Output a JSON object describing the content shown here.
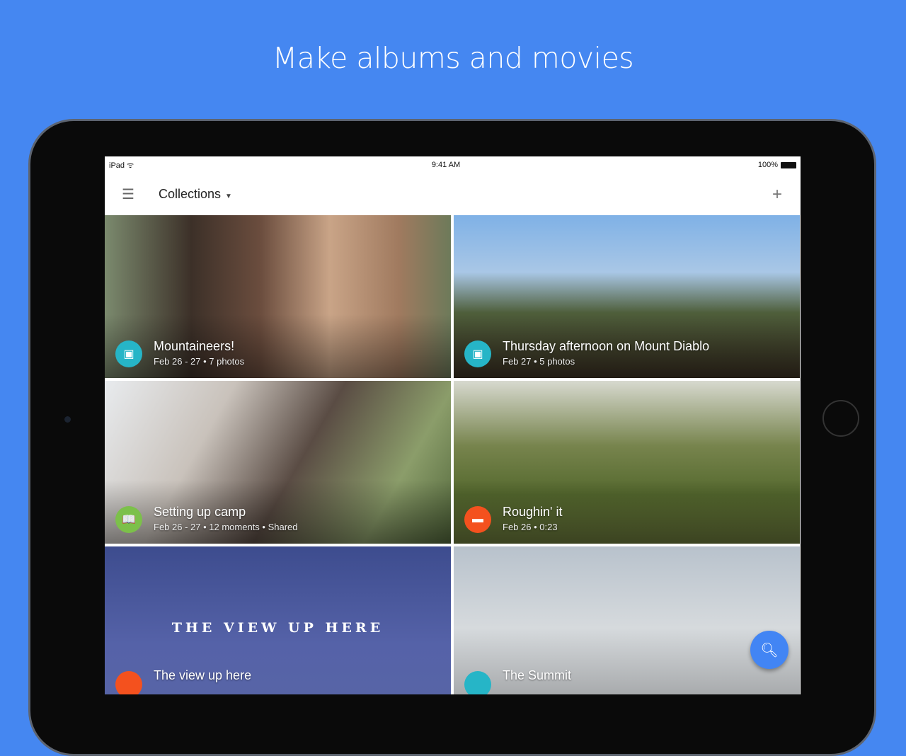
{
  "headline": "Make albums and movies",
  "status": {
    "device": "iPad",
    "time": "9:41 AM",
    "battery": "100%"
  },
  "appbar": {
    "title": "Collections"
  },
  "collections": [
    {
      "name": "Mountaineers!",
      "meta": "Feb 26 - 27  •  7 photos",
      "type": "album",
      "color": "#26b5c7"
    },
    {
      "name": "Thursday afternoon on Mount Diablo",
      "meta": "Feb 27  •  5 photos",
      "type": "album",
      "color": "#26b5c7"
    },
    {
      "name": "Setting up camp",
      "meta": "Feb 26 - 27  •  12 moments  •  Shared",
      "type": "story",
      "color": "#7cc04a"
    },
    {
      "name": "Roughin' it",
      "meta": "Feb 26  •  0:23",
      "type": "movie",
      "color": "#f4511e"
    },
    {
      "name": "The view up here",
      "overlay": "THE VIEW UP HERE",
      "type": "movie",
      "color": "#f4511e"
    },
    {
      "name": "The Summit",
      "type": "album",
      "color": "#26b5c7"
    }
  ]
}
